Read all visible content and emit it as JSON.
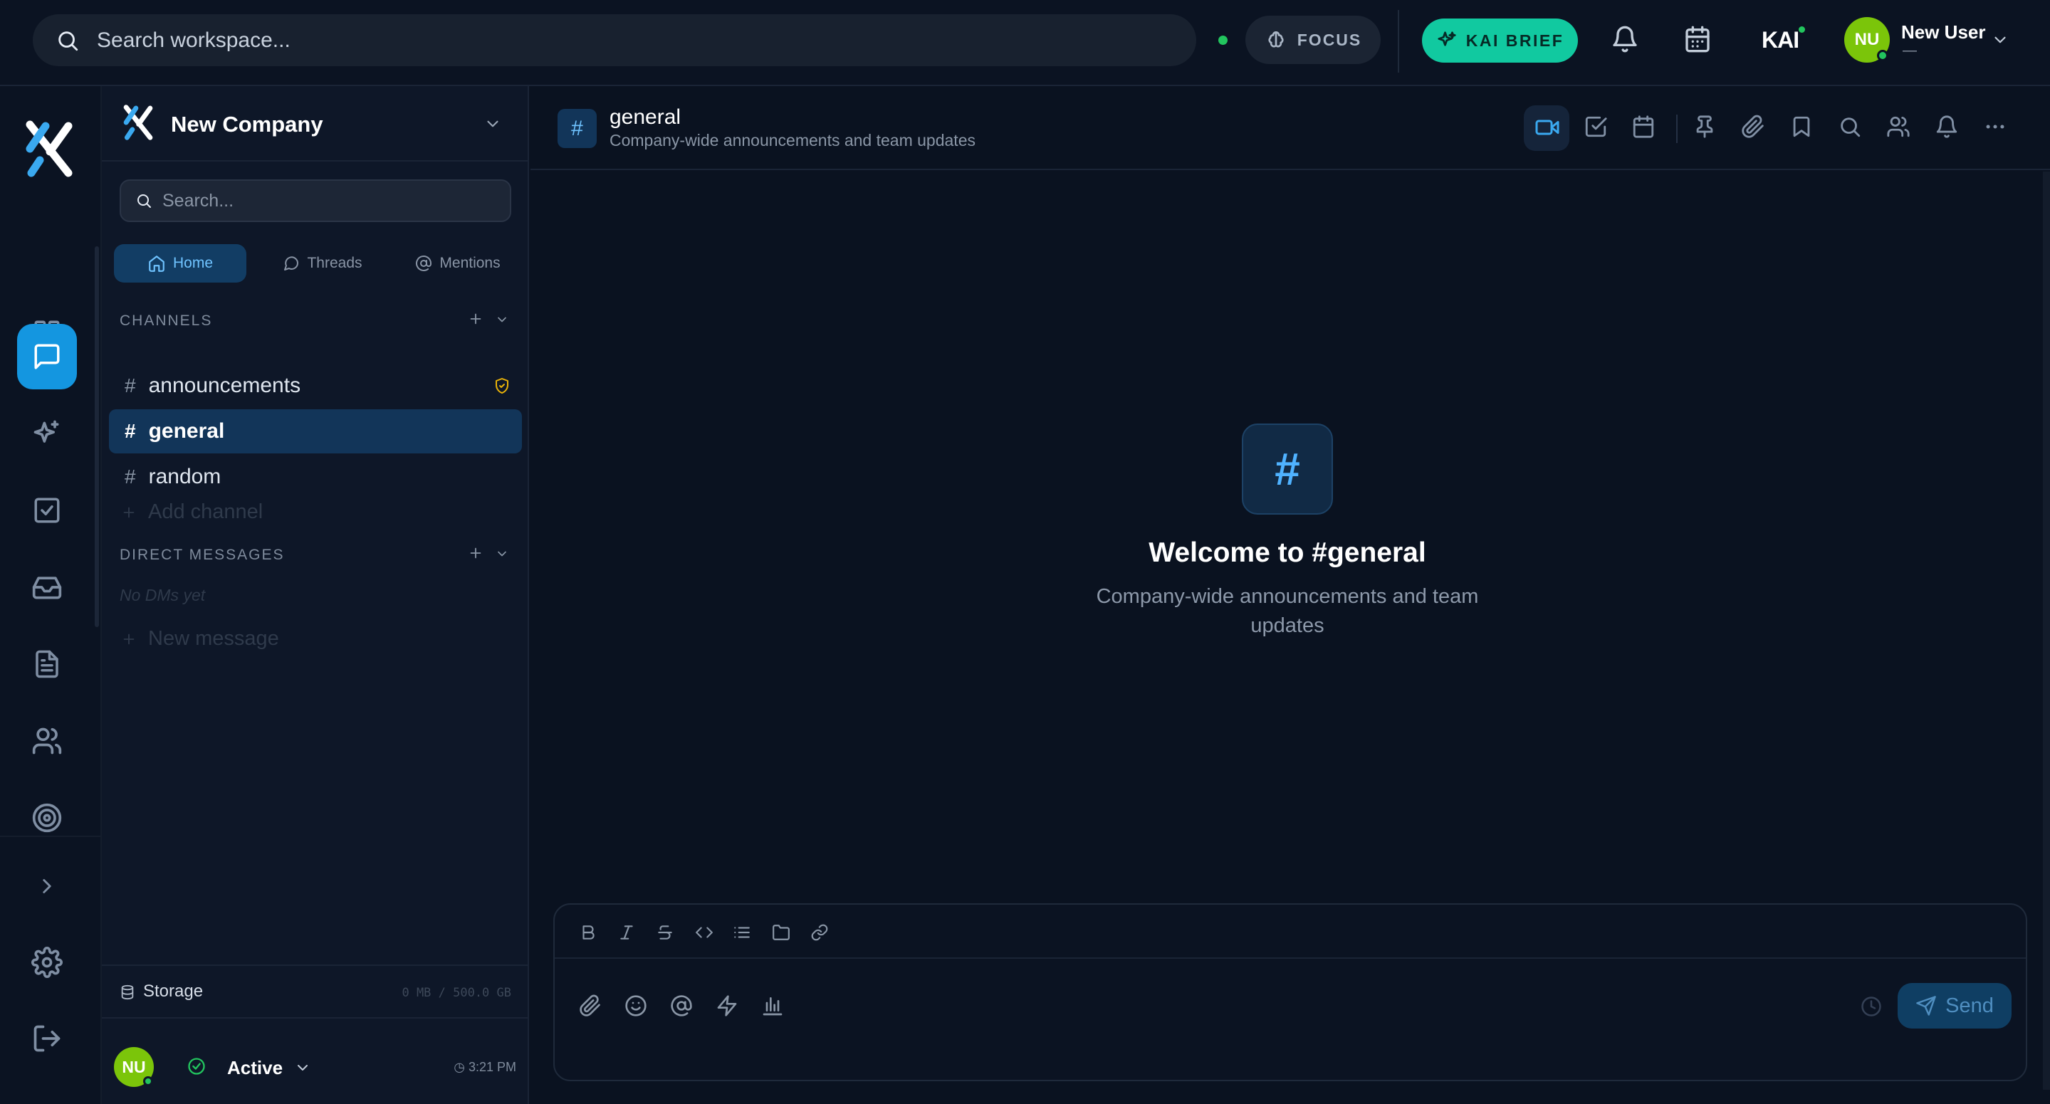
{
  "topbar": {
    "search_placeholder": "Search workspace...",
    "focus_label": "FOCUS",
    "kai_brief_label": "KAI BRIEF",
    "kai_mark": "KAI",
    "user_initials": "NU",
    "user_name": "New User",
    "user_sub": "—"
  },
  "sidebar": {
    "workspace_name": "New Company",
    "search_placeholder": "Search...",
    "tabs": [
      {
        "label": "Home",
        "icon": "home-icon",
        "active": true
      },
      {
        "label": "Threads",
        "icon": "speech-bubble-icon",
        "active": false
      },
      {
        "label": "Mentions",
        "icon": "at-icon",
        "active": false
      }
    ],
    "channels_title": "CHANNELS",
    "channels": [
      {
        "name": "announcements",
        "badge": "shield-icon"
      },
      {
        "name": "general",
        "active": true
      },
      {
        "name": "random"
      }
    ],
    "add_channel": "Add channel",
    "dm_title": "DIRECT MESSAGES",
    "no_dms": "No DMs yet",
    "new_message": "New message",
    "storage_label": "Storage",
    "storage_value": "0 MB / 500.0 GB",
    "footer": {
      "initials": "NU",
      "status": "Active",
      "time": "3:21 PM"
    }
  },
  "channel": {
    "badge": "#",
    "name": "general",
    "description": "Company-wide announcements and team updates",
    "welcome_title": "Welcome to #general",
    "welcome_desc": "Company-wide announcements and team updates"
  },
  "composer": {
    "send_label": "Send"
  },
  "colors": {
    "accent": "#1496e0",
    "kai": "#11c9a0",
    "online": "#22c55e",
    "avatar": "#7bc50a",
    "background": "#0a1220"
  }
}
